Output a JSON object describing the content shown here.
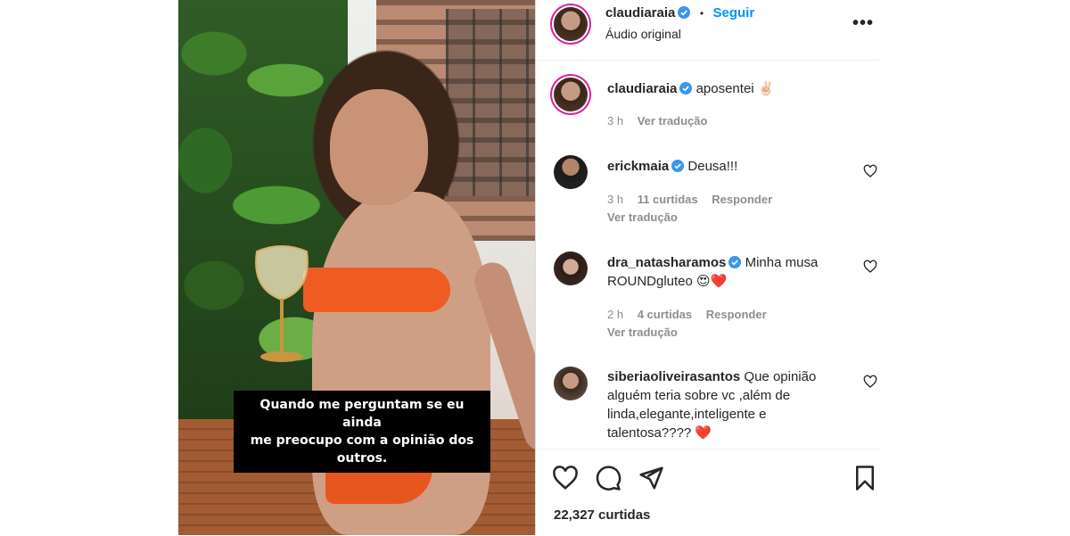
{
  "video": {
    "caption_line1": "Quando me perguntam se eu ainda",
    "caption_line2": "me preocupo com a opinião dos outros."
  },
  "header": {
    "username": "claudiaraia",
    "separator": "•",
    "follow_label": "Seguir",
    "audio_label": "Áudio original",
    "more_icon": "more-horizontal-icon",
    "more_glyph": "•••"
  },
  "caption": {
    "username": "claudiaraia",
    "text": "aposentei",
    "emoji": "✌🏻",
    "time": "3 h",
    "translate_label": "Ver tradução"
  },
  "comments": [
    {
      "username": "erickmaia",
      "verified": true,
      "text": "Deusa!!!",
      "time": "3 h",
      "likes_label": "11 curtidas",
      "reply_label": "Responder",
      "translate_label": "Ver tradução"
    },
    {
      "username": "dra_natasharamos",
      "verified": true,
      "text": "Minha musa",
      "text_line2": "ROUNDgluteo 😍❤️",
      "time": "2 h",
      "likes_label": "4 curtidas",
      "reply_label": "Responder",
      "translate_label": "Ver tradução"
    },
    {
      "username": "siberiaoliveirasantos",
      "verified": false,
      "text": "Que opinião",
      "text_line2": "alguém teria sobre vc ,além de",
      "text_line3": "linda,elegante,inteligente e",
      "text_line4": "talentosa???? ❤️"
    }
  ],
  "actions": {
    "icons": [
      "heart-icon",
      "comment-icon",
      "share-icon",
      "bookmark-icon"
    ],
    "likes": "22,327 curtidas"
  },
  "colors": {
    "accent": "#0095f6",
    "verified": "#3897f0",
    "muted": "#8e8e8e",
    "story_ring": "#d6249f"
  }
}
